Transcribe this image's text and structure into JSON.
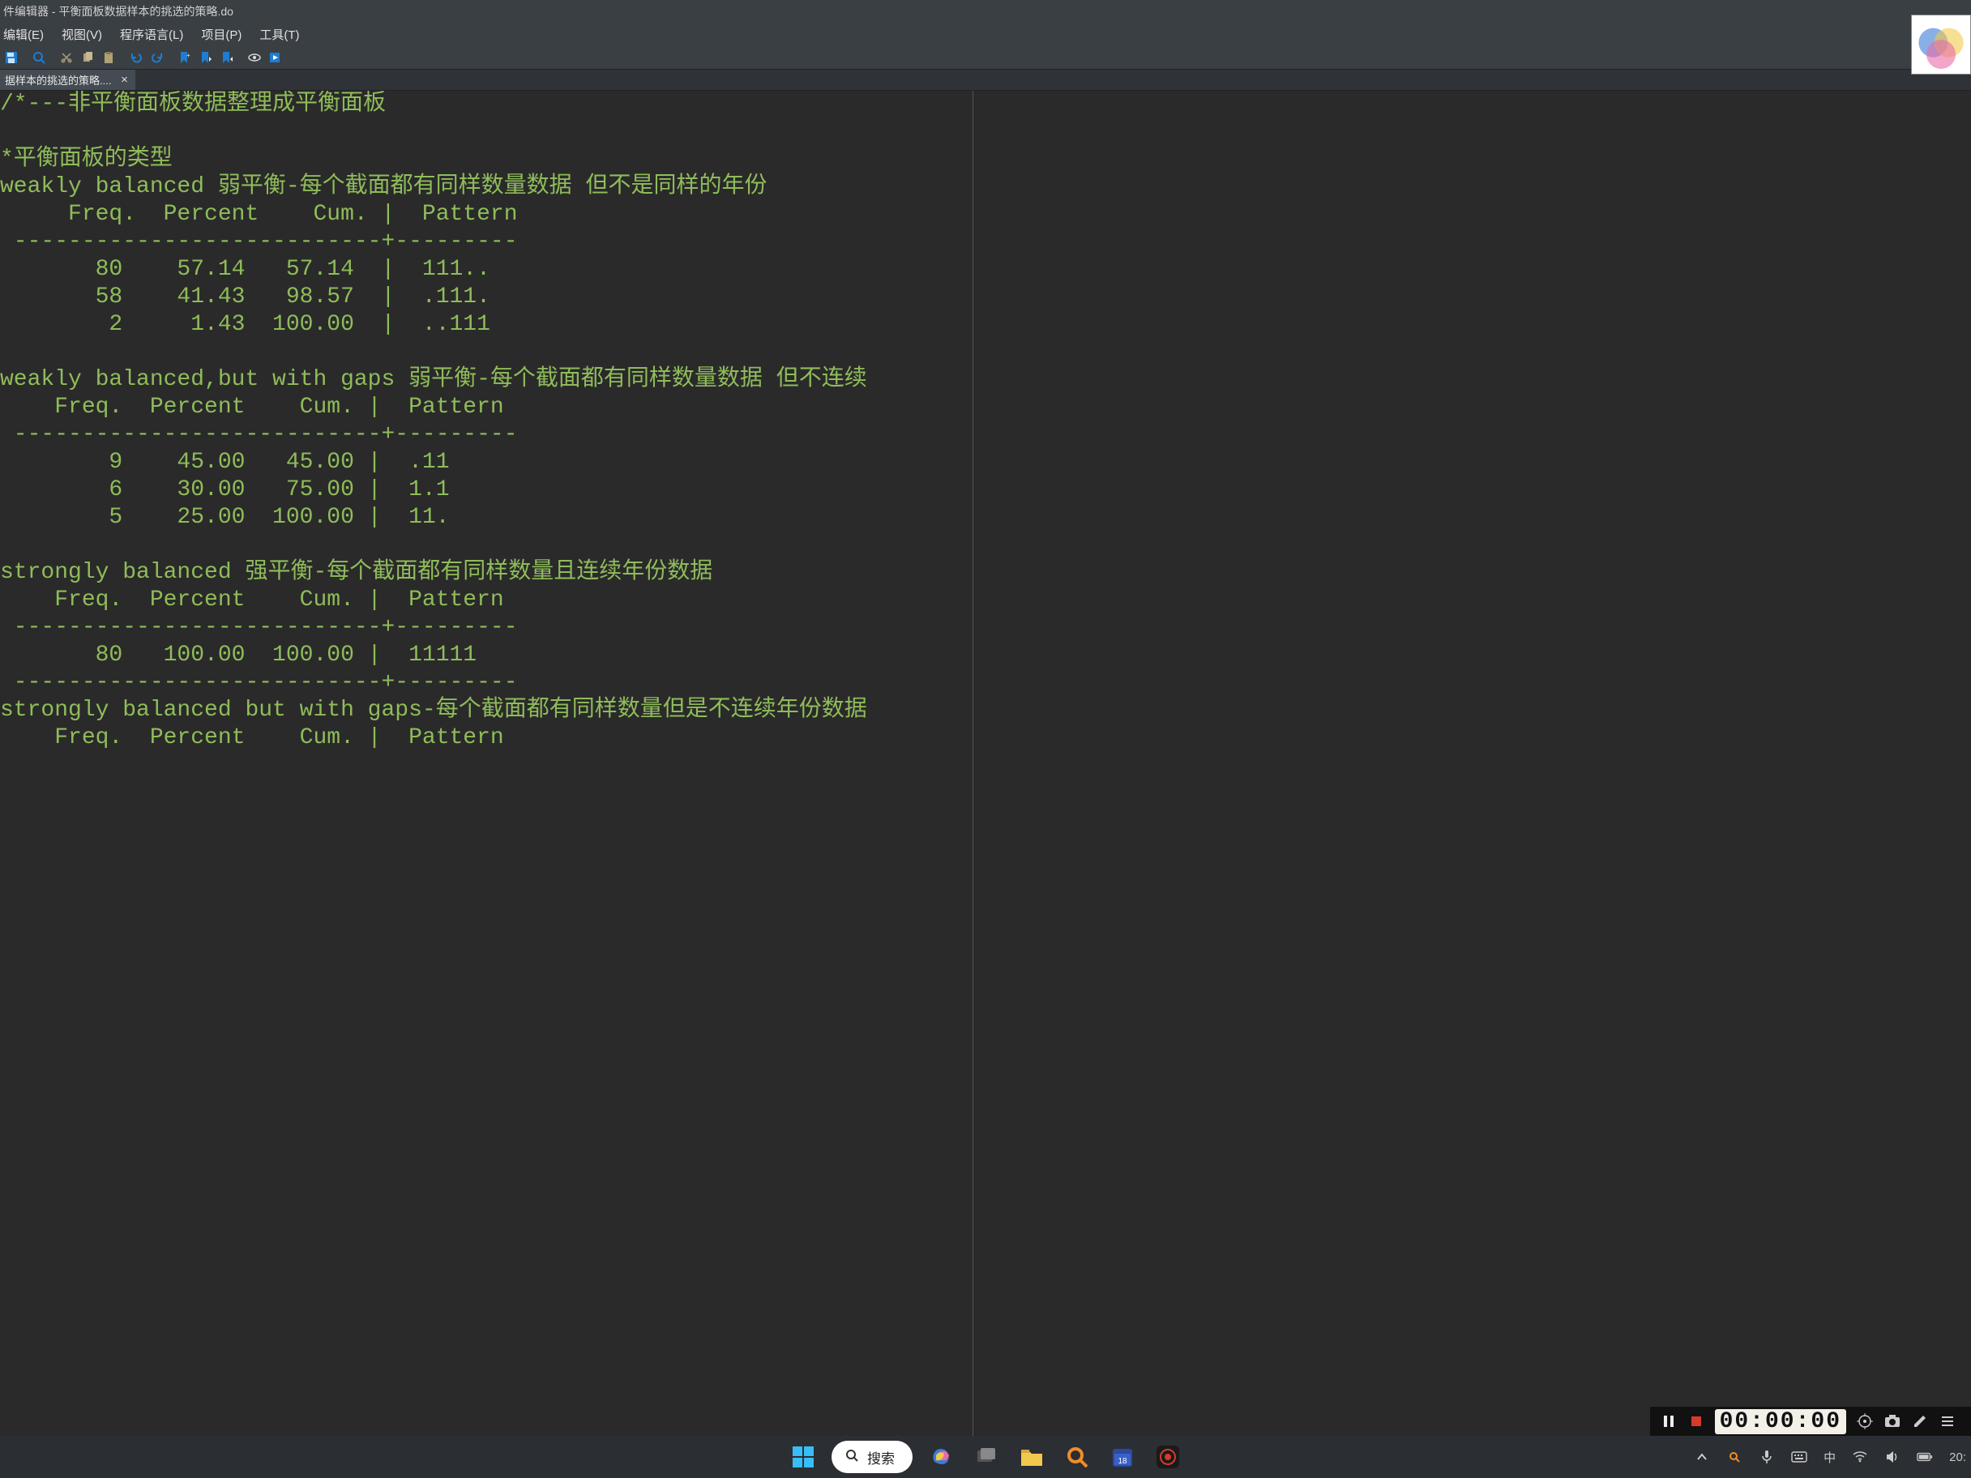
{
  "window": {
    "title": "件编辑器 - 平衡面板数据样本的挑选的策略.do"
  },
  "menu": {
    "edit": "编辑(E)",
    "view": "视图(V)",
    "lang": "程序语言(L)",
    "project": "项目(P)",
    "tools": "工具(T)"
  },
  "tab": {
    "label": "据样本的挑选的策略....",
    "close": "×"
  },
  "editor": {
    "lines": [
      "/*---非平衡面板数据整理成平衡面板",
      "",
      "*平衡面板的类型",
      "weakly balanced 弱平衡-每个截面都有同样数量数据 但不是同样的年份",
      "     Freq.  Percent    Cum. |  Pattern",
      " ---------------------------+---------",
      "       80    57.14   57.14  |  111..",
      "       58    41.43   98.57  |  .111.",
      "        2     1.43  100.00  |  ..111",
      "",
      "weakly balanced,but with gaps 弱平衡-每个截面都有同样数量数据 但不连续",
      "    Freq.  Percent    Cum. |  Pattern",
      " ---------------------------+---------",
      "        9    45.00   45.00 |  .11",
      "        6    30.00   75.00 |  1.1",
      "        5    25.00  100.00 |  11.",
      "",
      "strongly balanced 强平衡-每个截面都有同样数量且连续年份数据",
      "    Freq.  Percent    Cum. |  Pattern",
      " ---------------------------+---------",
      "       80   100.00  100.00 |  11111",
      " ---------------------------+---------",
      "strongly balanced but with gaps-每个截面都有同样数量但是不连续年份数据",
      "    Freq.  Percent    Cum. |  Pattern"
    ]
  },
  "recorder": {
    "timer": "00:00:00"
  },
  "taskbar": {
    "search": "搜索",
    "clock": "20:",
    "ime": "中"
  },
  "chart_data": [
    {
      "type": "table",
      "title": "weakly balanced 弱平衡-每个截面都有同样数量数据 但不是同样的年份",
      "columns": [
        "Freq.",
        "Percent",
        "Cum.",
        "Pattern"
      ],
      "rows": [
        [
          80,
          57.14,
          57.14,
          "111.."
        ],
        [
          58,
          41.43,
          98.57,
          ".111."
        ],
        [
          2,
          1.43,
          100.0,
          "..111"
        ]
      ]
    },
    {
      "type": "table",
      "title": "weakly balanced,but with gaps 弱平衡-每个截面都有同样数量数据 但不连续",
      "columns": [
        "Freq.",
        "Percent",
        "Cum.",
        "Pattern"
      ],
      "rows": [
        [
          9,
          45.0,
          45.0,
          ".11"
        ],
        [
          6,
          30.0,
          75.0,
          "1.1"
        ],
        [
          5,
          25.0,
          100.0,
          "11."
        ]
      ]
    },
    {
      "type": "table",
      "title": "strongly balanced 强平衡-每个截面都有同样数量且连续年份数据",
      "columns": [
        "Freq.",
        "Percent",
        "Cum.",
        "Pattern"
      ],
      "rows": [
        [
          80,
          100.0,
          100.0,
          "11111"
        ]
      ]
    },
    {
      "type": "table",
      "title": "strongly balanced but with gaps-每个截面都有同样数量但是不连续年份数据",
      "columns": [
        "Freq.",
        "Percent",
        "Cum.",
        "Pattern"
      ],
      "rows": []
    }
  ]
}
